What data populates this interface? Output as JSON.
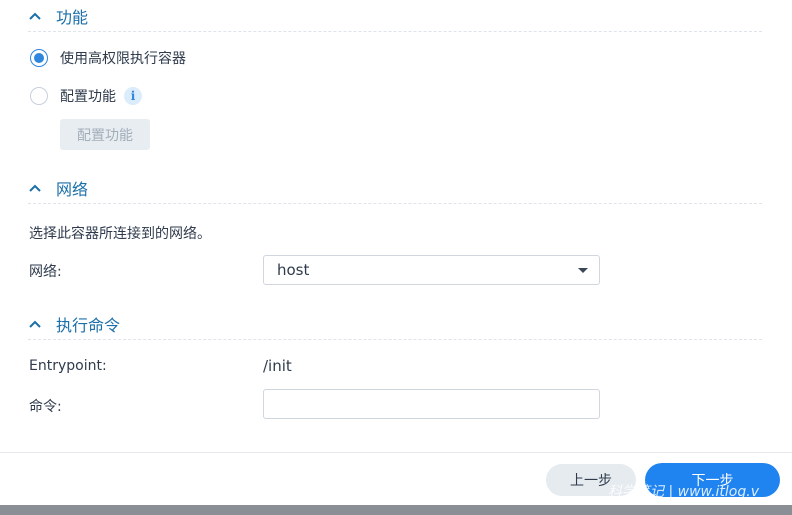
{
  "sections": {
    "features": {
      "title": "功能"
    },
    "network": {
      "title": "网络"
    },
    "command": {
      "title": "执行命令"
    }
  },
  "features": {
    "option_privileged": "使用高权限执行容器",
    "option_configure": "配置功能",
    "info_icon": "i",
    "configure_button": "配置功能"
  },
  "network": {
    "description": "选择此容器所连接到的网络。",
    "label": "网络:",
    "selected": "host"
  },
  "command": {
    "entrypoint_label": "Entrypoint:",
    "entrypoint_value": "/init",
    "command_label": "命令:",
    "command_value": ""
  },
  "footer": {
    "prev_label": "上一步",
    "next_label": "下一步",
    "watermark": "科学笔记 | www.itlog.v"
  },
  "colors": {
    "accent": "#2084f0",
    "section_title": "#1b6fa8",
    "radio_checked": "#2e86de"
  }
}
